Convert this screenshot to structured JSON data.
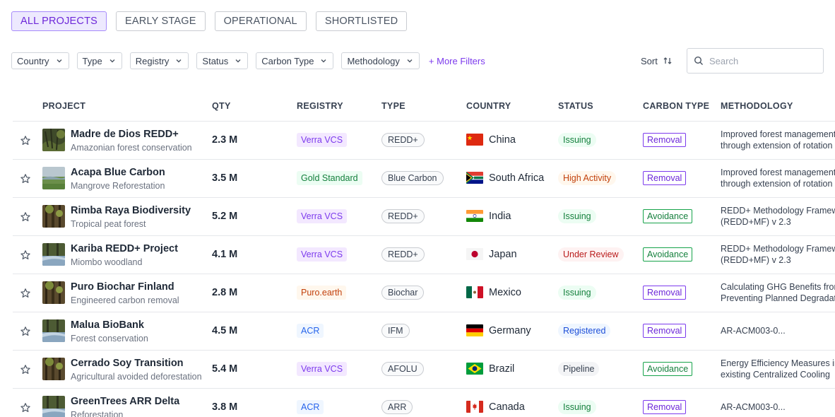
{
  "tabs": [
    {
      "label": "ALL PROJECTS",
      "active": true
    },
    {
      "label": "EARLY STAGE",
      "active": false
    },
    {
      "label": "OPERATIONAL",
      "active": false
    },
    {
      "label": "SHORTLISTED",
      "active": false
    }
  ],
  "filters": [
    "Country",
    "Type",
    "Registry",
    "Status",
    "Carbon Type",
    "Methodology"
  ],
  "more_filters_label": "+ More Filters",
  "sort_label": "Sort",
  "search_placeholder": "Search",
  "columns": {
    "project": "PROJECT",
    "qty": "QTY",
    "registry": "REGISTRY",
    "type": "TYPE",
    "country": "COUNTRY",
    "status": "STATUS",
    "carbon_type": "CARBON TYPE",
    "methodology": "METHODOLOGY"
  },
  "rows": [
    {
      "name": "Madre de Dios REDD+",
      "subtitle": "Amazonian forest conservation",
      "qty": "2.3 M",
      "registry": "Verra VCS",
      "registry_kind": "verra",
      "type": "REDD+",
      "country": "China",
      "flag": "cn",
      "status": "Issuing",
      "status_kind": "issuing",
      "carbon_type": "Removal",
      "carbon_kind": "removal",
      "methodology": [
        "Improved forest management",
        "through extension of rotation age"
      ],
      "thumb": "forest"
    },
    {
      "name": "Acapa Blue Carbon",
      "subtitle": "Mangrove Reforestation",
      "qty": "3.5 M",
      "registry": "Gold Standard",
      "registry_kind": "gold",
      "type": "Blue Carbon",
      "country": "South Africa",
      "flag": "za",
      "status": "High Activity",
      "status_kind": "high",
      "carbon_type": "Removal",
      "carbon_kind": "removal",
      "methodology": [
        "Improved forest management",
        "through extension of rotation age"
      ],
      "thumb": "meadow"
    },
    {
      "name": "Rimba Raya Biodiversity",
      "subtitle": "Tropical peat forest",
      "qty": "5.2 M",
      "registry": "Verra VCS",
      "registry_kind": "verra",
      "type": "REDD+",
      "country": "India",
      "flag": "in",
      "status": "Issuing",
      "status_kind": "issuing",
      "carbon_type": "Avoidance",
      "carbon_kind": "avoid",
      "methodology": [
        "REDD+ Methodology Framework",
        "(REDD+MF) v 2.3"
      ],
      "thumb": "trees"
    },
    {
      "name": "Kariba REDD+ Project",
      "subtitle": "Miombo woodland",
      "qty": "4.1 M",
      "registry": "Verra VCS",
      "registry_kind": "verra",
      "type": "REDD+",
      "country": "Japan",
      "flag": "jp",
      "status": "Under Review",
      "status_kind": "review",
      "carbon_type": "Avoidance",
      "carbon_kind": "avoid",
      "methodology": [
        "REDD+ Methodology Framework",
        "(REDD+MF) v 2.3"
      ],
      "thumb": "river"
    },
    {
      "name": "Puro Biochar Finland",
      "subtitle": "Engineered carbon removal",
      "qty": "2.8 M",
      "registry": "Puro.earth",
      "registry_kind": "puro",
      "type": "Biochar",
      "country": "Mexico",
      "flag": "mx",
      "status": "Issuing",
      "status_kind": "issuing",
      "carbon_type": "Removal",
      "carbon_kind": "removal",
      "methodology": [
        "Calculating GHG Benefits from",
        "Preventing Planned Degradation"
      ],
      "thumb": "trees"
    },
    {
      "name": "Malua BioBank",
      "subtitle": "Forest conservation",
      "qty": "4.5 M",
      "registry": "ACR",
      "registry_kind": "acr",
      "type": "IFM",
      "country": "Germany",
      "flag": "de",
      "status": "Registered",
      "status_kind": "registered",
      "carbon_type": "Removal",
      "carbon_kind": "removal",
      "methodology": [
        "AR-ACM003-0..."
      ],
      "thumb": "river"
    },
    {
      "name": "Cerrado Soy Transition",
      "subtitle": "Agricultural avoided deforestation",
      "qty": "5.4 M",
      "registry": "Verra VCS",
      "registry_kind": "verra",
      "type": "AFOLU",
      "country": "Brazil",
      "flag": "br",
      "status": "Pipeline",
      "status_kind": "pipeline",
      "carbon_type": "Avoidance",
      "carbon_kind": "avoid",
      "methodology": [
        "Energy Efficiency Measures in",
        "existing Centralized Cooling"
      ],
      "thumb": "trees"
    },
    {
      "name": "GreenTrees ARR Delta",
      "subtitle": "Reforestation",
      "qty": "3.8 M",
      "registry": "ACR",
      "registry_kind": "acr",
      "type": "ARR",
      "country": "Canada",
      "flag": "ca",
      "status": "Issuing",
      "status_kind": "issuing",
      "carbon_type": "Removal",
      "carbon_kind": "removal",
      "methodology": [
        "AR-ACM003-0..."
      ],
      "thumb": "river"
    }
  ]
}
